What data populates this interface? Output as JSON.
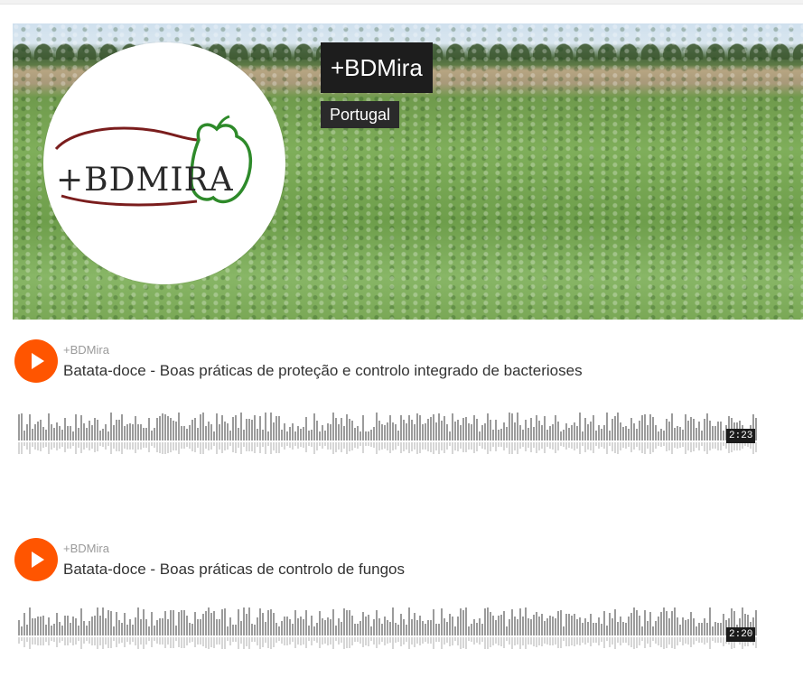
{
  "profile": {
    "username": "+BDMira",
    "country": "Portugal",
    "logo_text": "+BDMIRA"
  },
  "tracks": [
    {
      "artist": "+BDMira",
      "title": "Batata-doce - Boas práticas de proteção e controlo integrado de bacterioses",
      "duration": "2:23"
    },
    {
      "artist": "+BDMira",
      "title": "Batata-doce - Boas práticas de controlo de fungos",
      "duration": "2:20"
    }
  ],
  "colors": {
    "accent": "#ff5500",
    "waveform": "#9b9b9b",
    "waveform_reflection": "#d6d6d6"
  },
  "icons": {
    "play": "play-icon"
  }
}
